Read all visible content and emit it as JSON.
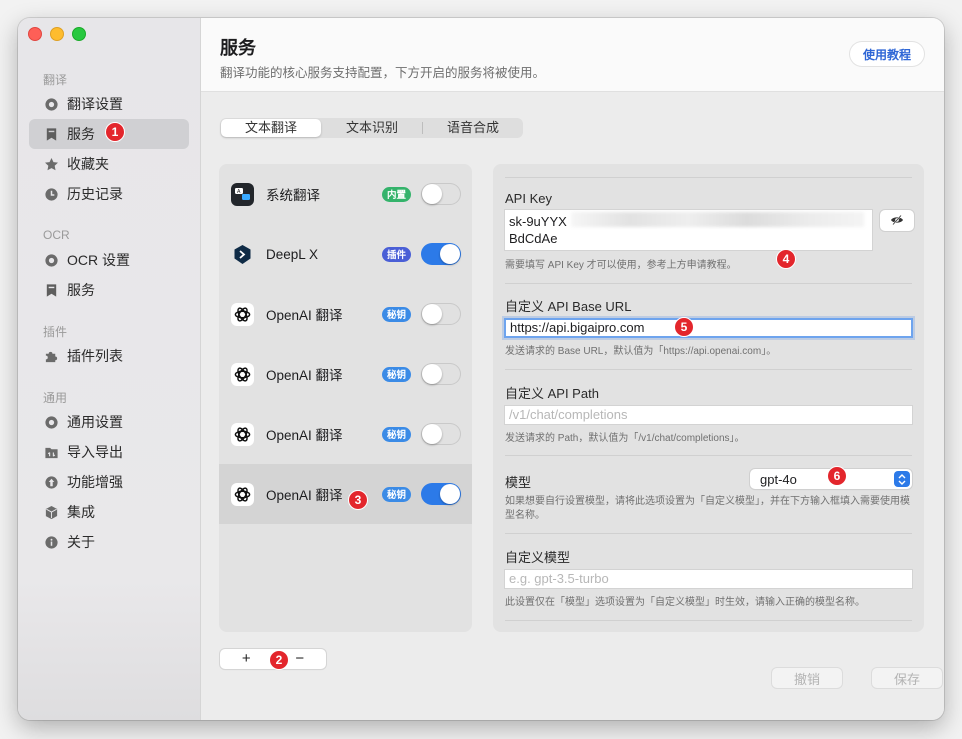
{
  "sidebar": {
    "sections": [
      {
        "label": "翻译",
        "items": [
          {
            "label": "翻译设置",
            "icon": "gear-icon"
          },
          {
            "label": "服务",
            "icon": "bookmark-icon",
            "active": true
          },
          {
            "label": "收藏夹",
            "icon": "star-icon"
          },
          {
            "label": "历史记录",
            "icon": "clock-icon"
          }
        ]
      },
      {
        "label": "OCR",
        "items": [
          {
            "label": "OCR 设置",
            "icon": "gear-icon"
          },
          {
            "label": "服务",
            "icon": "bookmark-icon"
          }
        ]
      },
      {
        "label": "插件",
        "items": [
          {
            "label": "插件列表",
            "icon": "puzzle-icon"
          }
        ]
      },
      {
        "label": "通用",
        "items": [
          {
            "label": "通用设置",
            "icon": "gear-icon"
          },
          {
            "label": "导入导出",
            "icon": "import-export-icon"
          },
          {
            "label": "功能增强",
            "icon": "up-arrow-icon"
          },
          {
            "label": "集成",
            "icon": "cube-icon"
          },
          {
            "label": "关于",
            "icon": "info-icon"
          }
        ]
      }
    ]
  },
  "header": {
    "title": "服务",
    "subtitle": "翻译功能的核心服务支持配置，下方开启的服务将被使用。",
    "tutorial_label": "使用教程"
  },
  "tabs": [
    "文本翻译",
    "文本识别",
    "语音合成"
  ],
  "services": [
    {
      "name": "系统翻译",
      "tag": "内置",
      "tag_color": "#34b36b",
      "enabled": false,
      "logo": "system-translate-logo"
    },
    {
      "name": "DeepL X",
      "tag": "插件",
      "tag_color": "#4a5fd6",
      "enabled": true,
      "logo": "deepl-logo"
    },
    {
      "name": "OpenAI 翻译",
      "tag": "秘钥",
      "tag_color": "#3b8be6",
      "enabled": false,
      "logo": "openai-logo"
    },
    {
      "name": "OpenAI 翻译",
      "tag": "秘钥",
      "tag_color": "#3b8be6",
      "enabled": false,
      "logo": "openai-logo"
    },
    {
      "name": "OpenAI 翻译",
      "tag": "秘钥",
      "tag_color": "#3b8be6",
      "enabled": false,
      "logo": "openai-logo"
    },
    {
      "name": "OpenAI 翻译",
      "tag": "秘钥",
      "tag_color": "#3b8be6",
      "enabled": true,
      "logo": "openai-logo",
      "selected": true
    }
  ],
  "list_controls": {
    "add": "+",
    "remove": "−"
  },
  "detail": {
    "api_key": {
      "label": "API Key",
      "value_line1": "sk-9uYYX",
      "value_line2": "BdCdAe",
      "hint": "需要填写 API Key 才可以使用，参考上方申请教程。"
    },
    "base_url": {
      "label": "自定义 API Base URL",
      "value": "https://api.bigaipro.com",
      "hint": "发送请求的 Base URL，默认值为「https://api.openai.com」。"
    },
    "api_path": {
      "label": "自定义 API Path",
      "placeholder": "/v1/chat/completions",
      "hint": "发送请求的 Path，默认值为「/v1/chat/completions」。"
    },
    "model": {
      "label": "模型",
      "value": "gpt-4o",
      "hint": "如果想要自行设置模型，请将此选项设置为「自定义模型」，并在下方输入框填入需要使用模型名称。"
    },
    "custom_model": {
      "label": "自定义模型",
      "placeholder": "e.g. gpt-3.5-turbo",
      "hint": "此设置仅在「模型」选项设置为「自定义模型」时生效，请输入正确的模型名称。"
    }
  },
  "actions": {
    "cancel": "撤销",
    "save": "保存"
  },
  "annotations": [
    "1",
    "2",
    "3",
    "4",
    "5",
    "6"
  ],
  "colors": {
    "accent": "#2c7ae8",
    "annotation": "#e3262c",
    "link": "#2f67d6"
  }
}
